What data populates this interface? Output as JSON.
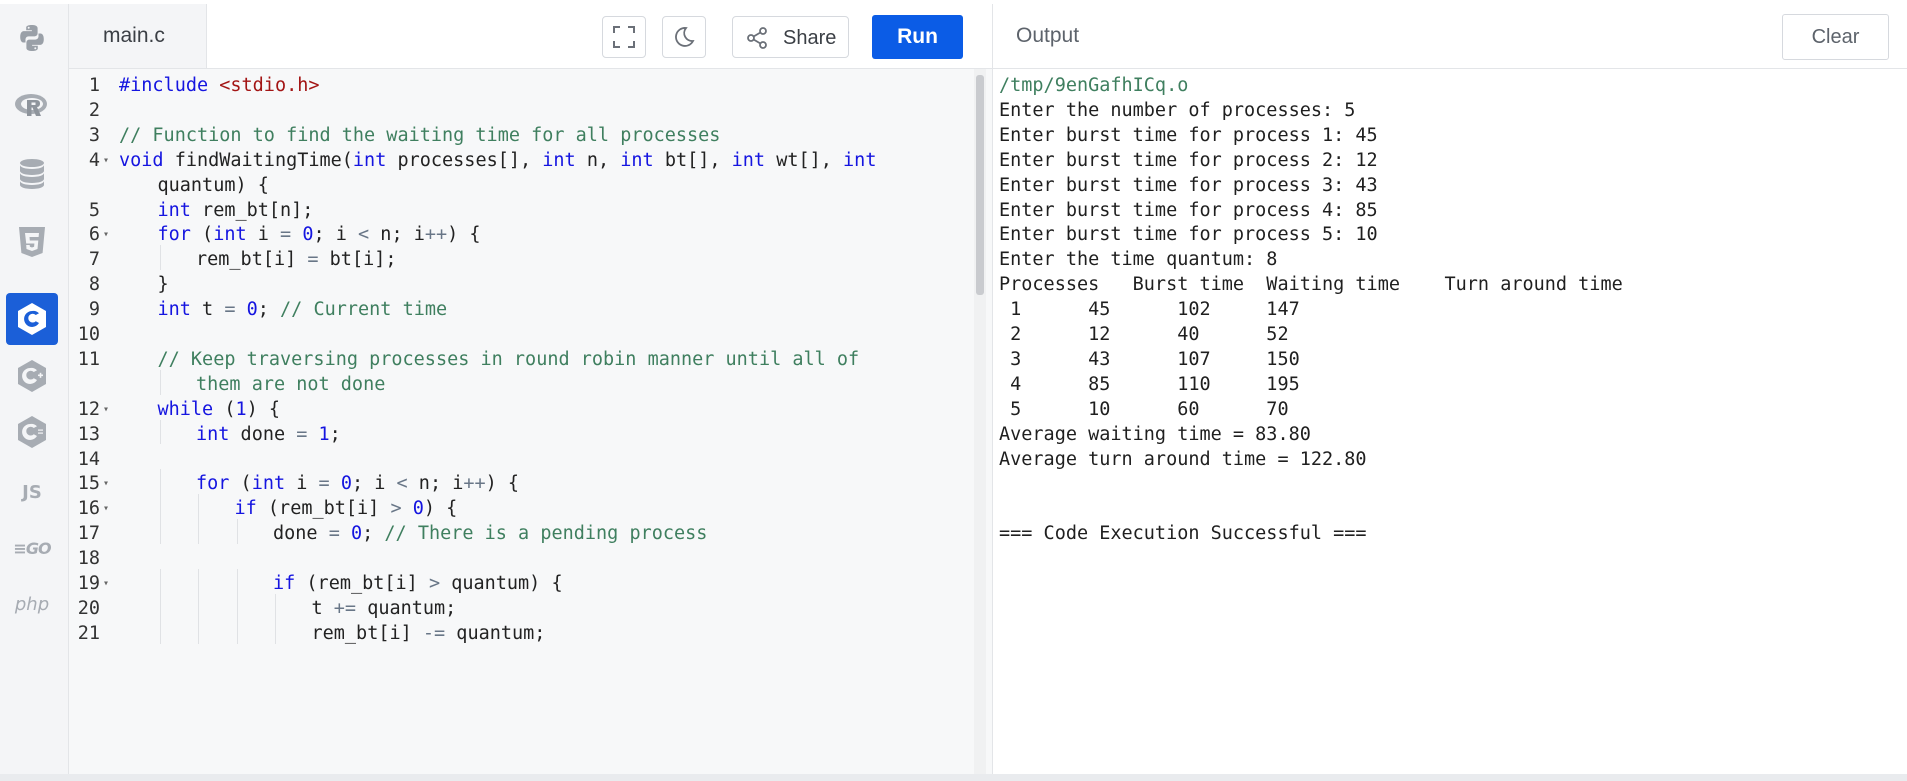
{
  "editor": {
    "tab_label": "main.c",
    "lines": [
      {
        "n": "1",
        "fold": false,
        "indent": 0,
        "tokens": [
          {
            "t": "kw",
            "v": "#include"
          },
          {
            "t": "p",
            "v": " "
          },
          {
            "t": "str",
            "v": "<stdio.h>"
          }
        ]
      },
      {
        "n": "2",
        "fold": false,
        "indent": 0,
        "tokens": []
      },
      {
        "n": "3",
        "fold": false,
        "indent": 0,
        "tokens": [
          {
            "t": "cm",
            "v": "// Function to find the waiting time for all processes"
          }
        ]
      },
      {
        "n": "4",
        "fold": true,
        "indent": 0,
        "tokens": [
          {
            "t": "kw",
            "v": "void"
          },
          {
            "t": "p",
            "v": " findWaitingTime("
          },
          {
            "t": "kw",
            "v": "int"
          },
          {
            "t": "p",
            "v": " processes[], "
          },
          {
            "t": "kw",
            "v": "int"
          },
          {
            "t": "p",
            "v": " n, "
          },
          {
            "t": "kw",
            "v": "int"
          },
          {
            "t": "p",
            "v": " bt[], "
          },
          {
            "t": "kw",
            "v": "int"
          },
          {
            "t": "p",
            "v": " wt[], "
          },
          {
            "t": "kw",
            "v": "int"
          }
        ]
      },
      {
        "n": "",
        "fold": false,
        "indent": 1,
        "tokens": [
          {
            "t": "p",
            "v": "quantum) {"
          }
        ]
      },
      {
        "n": "5",
        "fold": false,
        "indent": 1,
        "tokens": [
          {
            "t": "kw",
            "v": "int"
          },
          {
            "t": "p",
            "v": " rem_bt[n];"
          }
        ]
      },
      {
        "n": "6",
        "fold": true,
        "indent": 1,
        "tokens": [
          {
            "t": "kw",
            "v": "for"
          },
          {
            "t": "p",
            "v": " ("
          },
          {
            "t": "kw",
            "v": "int"
          },
          {
            "t": "p",
            "v": " i "
          },
          {
            "t": "op",
            "v": "="
          },
          {
            "t": "p",
            "v": " "
          },
          {
            "t": "num",
            "v": "0"
          },
          {
            "t": "p",
            "v": "; i "
          },
          {
            "t": "op",
            "v": "<"
          },
          {
            "t": "p",
            "v": " n; i"
          },
          {
            "t": "op",
            "v": "++"
          },
          {
            "t": "p",
            "v": ") {"
          }
        ]
      },
      {
        "n": "7",
        "fold": false,
        "indent": 2,
        "tokens": [
          {
            "t": "p",
            "v": "rem_bt[i] "
          },
          {
            "t": "op",
            "v": "="
          },
          {
            "t": "p",
            "v": " bt[i];"
          }
        ]
      },
      {
        "n": "8",
        "fold": false,
        "indent": 1,
        "tokens": [
          {
            "t": "p",
            "v": "}"
          }
        ]
      },
      {
        "n": "9",
        "fold": false,
        "indent": 1,
        "tokens": [
          {
            "t": "kw",
            "v": "int"
          },
          {
            "t": "p",
            "v": " t "
          },
          {
            "t": "op",
            "v": "="
          },
          {
            "t": "p",
            "v": " "
          },
          {
            "t": "num",
            "v": "0"
          },
          {
            "t": "p",
            "v": "; "
          },
          {
            "t": "cm",
            "v": "// Current time"
          }
        ]
      },
      {
        "n": "10",
        "fold": false,
        "indent": 0,
        "tokens": []
      },
      {
        "n": "11",
        "fold": false,
        "indent": 1,
        "tokens": [
          {
            "t": "cm",
            "v": "// Keep traversing processes in round robin manner until all of"
          }
        ]
      },
      {
        "n": "",
        "fold": false,
        "indent": 2,
        "tokens": [
          {
            "t": "cm",
            "v": "them are not done"
          }
        ]
      },
      {
        "n": "12",
        "fold": true,
        "indent": 1,
        "tokens": [
          {
            "t": "kw",
            "v": "while"
          },
          {
            "t": "p",
            "v": " ("
          },
          {
            "t": "num",
            "v": "1"
          },
          {
            "t": "p",
            "v": ") {"
          }
        ]
      },
      {
        "n": "13",
        "fold": false,
        "indent": 2,
        "tokens": [
          {
            "t": "kw",
            "v": "int"
          },
          {
            "t": "p",
            "v": " done "
          },
          {
            "t": "op",
            "v": "="
          },
          {
            "t": "p",
            "v": " "
          },
          {
            "t": "num",
            "v": "1"
          },
          {
            "t": "p",
            "v": ";"
          }
        ]
      },
      {
        "n": "14",
        "fold": false,
        "indent": 0,
        "tokens": []
      },
      {
        "n": "15",
        "fold": true,
        "indent": 2,
        "tokens": [
          {
            "t": "kw",
            "v": "for"
          },
          {
            "t": "p",
            "v": " ("
          },
          {
            "t": "kw",
            "v": "int"
          },
          {
            "t": "p",
            "v": " i "
          },
          {
            "t": "op",
            "v": "="
          },
          {
            "t": "p",
            "v": " "
          },
          {
            "t": "num",
            "v": "0"
          },
          {
            "t": "p",
            "v": "; i "
          },
          {
            "t": "op",
            "v": "<"
          },
          {
            "t": "p",
            "v": " n; i"
          },
          {
            "t": "op",
            "v": "++"
          },
          {
            "t": "p",
            "v": ") {"
          }
        ]
      },
      {
        "n": "16",
        "fold": true,
        "indent": 3,
        "tokens": [
          {
            "t": "kw",
            "v": "if"
          },
          {
            "t": "p",
            "v": " (rem_bt[i] "
          },
          {
            "t": "op",
            "v": ">"
          },
          {
            "t": "p",
            "v": " "
          },
          {
            "t": "num",
            "v": "0"
          },
          {
            "t": "p",
            "v": ") {"
          }
        ]
      },
      {
        "n": "17",
        "fold": false,
        "indent": 4,
        "tokens": [
          {
            "t": "p",
            "v": "done "
          },
          {
            "t": "op",
            "v": "="
          },
          {
            "t": "p",
            "v": " "
          },
          {
            "t": "num",
            "v": "0"
          },
          {
            "t": "p",
            "v": "; "
          },
          {
            "t": "cm",
            "v": "// There is a pending process"
          }
        ]
      },
      {
        "n": "18",
        "fold": false,
        "indent": 0,
        "tokens": []
      },
      {
        "n": "19",
        "fold": true,
        "indent": 4,
        "tokens": [
          {
            "t": "kw",
            "v": "if"
          },
          {
            "t": "p",
            "v": " (rem_bt[i] "
          },
          {
            "t": "op",
            "v": ">"
          },
          {
            "t": "p",
            "v": " quantum) {"
          }
        ]
      },
      {
        "n": "20",
        "fold": false,
        "indent": 5,
        "tokens": [
          {
            "t": "p",
            "v": "t "
          },
          {
            "t": "op",
            "v": "+="
          },
          {
            "t": "p",
            "v": " quantum;"
          }
        ]
      },
      {
        "n": "21",
        "fold": false,
        "indent": 5,
        "tokens": [
          {
            "t": "p",
            "v": "rem_bt[i] "
          },
          {
            "t": "op",
            "v": "-="
          },
          {
            "t": "p",
            "v": " quantum;"
          }
        ]
      }
    ]
  },
  "toolbar": {
    "share_label": "Share",
    "run_label": "Run",
    "fullscreen_icon": "fullscreen-icon",
    "theme_icon": "moon-icon",
    "share_icon": "share-icon"
  },
  "output": {
    "title": "Output",
    "clear_label": "Clear",
    "lines": [
      "/tmp/9enGafhICq.o",
      "Enter the number of processes: 5",
      "Enter burst time for process 1: 45",
      "Enter burst time for process 2: 12",
      "Enter burst time for process 3: 43",
      "Enter burst time for process 4: 85",
      "Enter burst time for process 5: 10",
      "Enter the time quantum: 8",
      "Processes   Burst time  Waiting time    Turn around time",
      " 1      45      102     147",
      " 2      12      40      52",
      " 3      43      107     150",
      " 4      85      110     195",
      " 5      10      60      70",
      "Average waiting time = 83.80",
      "Average turn around time = 122.80",
      "",
      "",
      "=== Code Execution Successful ==="
    ]
  },
  "sidebar": {
    "languages": [
      {
        "name": "python",
        "icon": "python-icon",
        "active": false
      },
      {
        "name": "r",
        "icon": "r-icon",
        "active": false
      },
      {
        "name": "sql",
        "icon": "database-icon",
        "active": false
      },
      {
        "name": "html",
        "icon": "html5-icon",
        "active": false
      },
      {
        "name": "java",
        "icon": "java-icon",
        "active": false
      },
      {
        "name": "c",
        "icon": "c-icon",
        "active": true
      },
      {
        "name": "cpp",
        "icon": "cpp-icon",
        "active": false
      },
      {
        "name": "csharp",
        "icon": "csharp-icon",
        "active": false
      },
      {
        "name": "js",
        "icon": "js-icon",
        "label": "JS",
        "active": false
      },
      {
        "name": "go",
        "icon": "go-icon",
        "label": "GO",
        "active": false
      },
      {
        "name": "php",
        "icon": "php-icon",
        "label": "php",
        "active": false
      }
    ]
  },
  "colors": {
    "accent": "#0b5ce6",
    "keyword": "#1515e0",
    "string": "#a31515",
    "comment": "#3f7f5f"
  }
}
